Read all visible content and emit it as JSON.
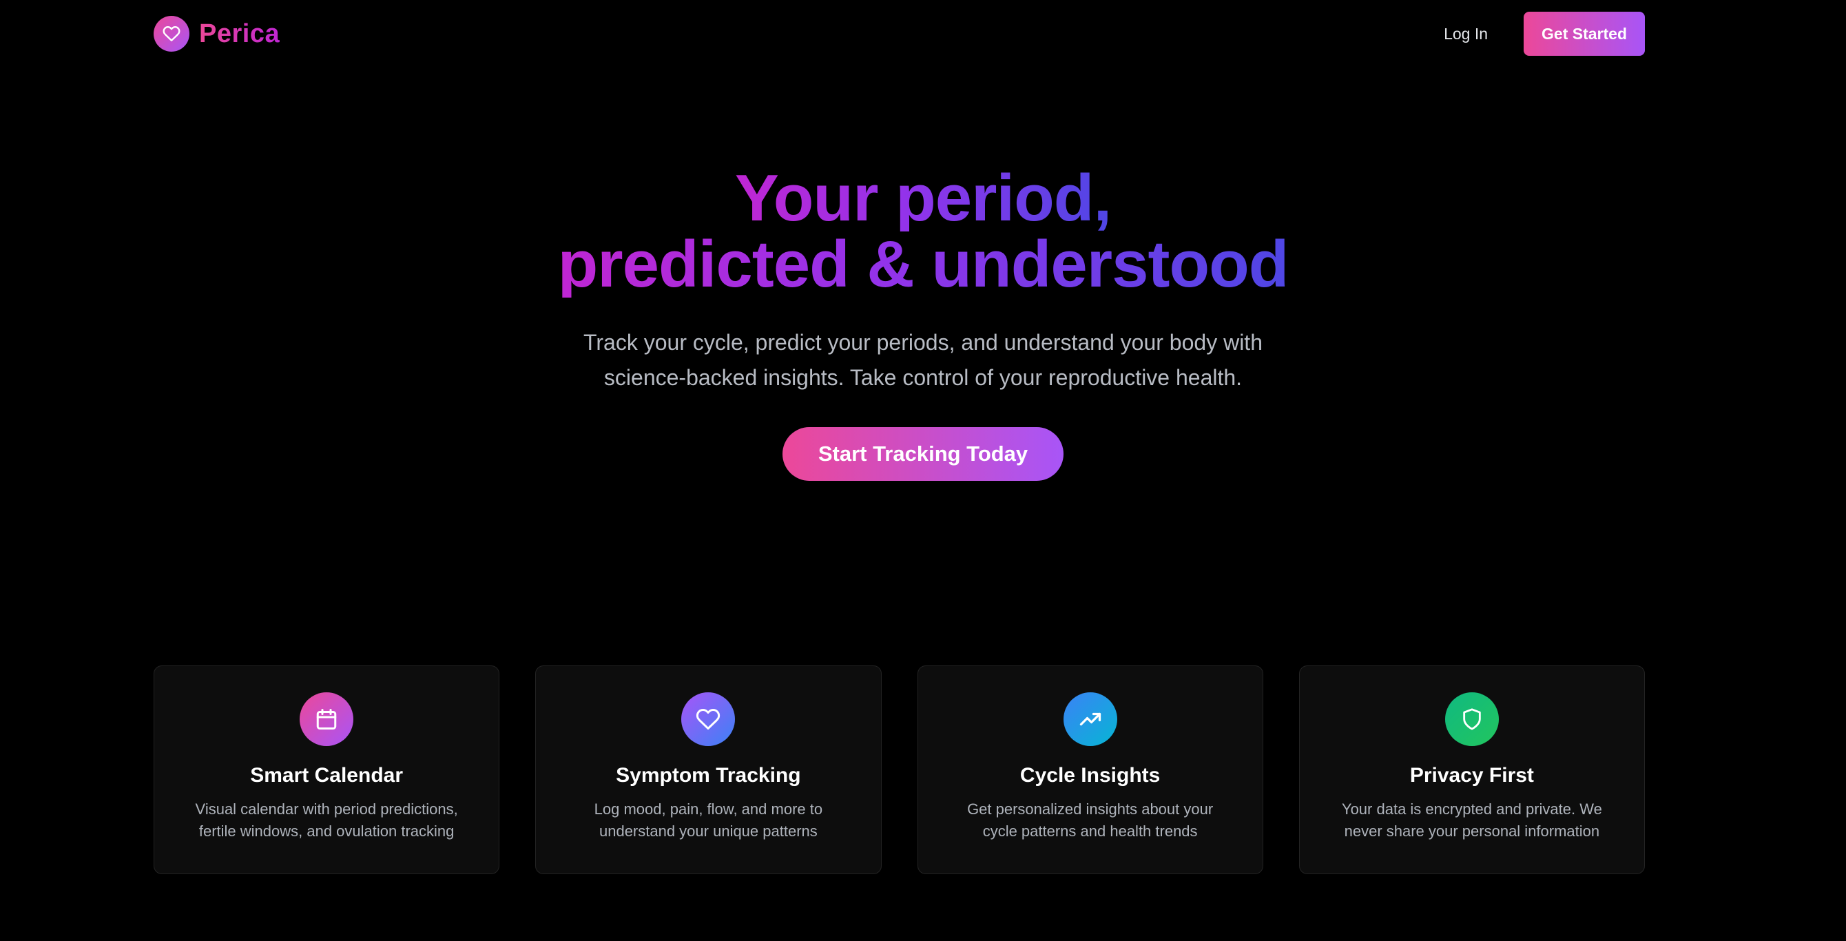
{
  "header": {
    "brand_name": "Perica",
    "login_label": "Log In",
    "get_started_label": "Get Started"
  },
  "hero": {
    "title_line1": "Your period,",
    "title_line2": "predicted & understood",
    "subtitle": "Track your cycle, predict your periods, and understand your body with science-backed insights. Take control of your reproductive health.",
    "cta_label": "Start Tracking Today"
  },
  "features": [
    {
      "icon": "calendar-icon",
      "title": "Smart Calendar",
      "description": "Visual calendar with period predictions, fertile windows, and ovulation tracking"
    },
    {
      "icon": "heart-icon",
      "title": "Symptom Tracking",
      "description": "Log mood, pain, flow, and more to understand your unique patterns"
    },
    {
      "icon": "trending-up-icon",
      "title": "Cycle Insights",
      "description": "Get personalized insights about your cycle patterns and health trends"
    },
    {
      "icon": "shield-icon",
      "title": "Privacy First",
      "description": "Your data is encrypted and private. We never share your personal information"
    }
  ],
  "colors": {
    "background": "#000000",
    "accent_pink": "#ec4899",
    "accent_purple": "#a855f7",
    "accent_indigo": "#4f46e5",
    "card_background": "#0d0d0d",
    "icon_gradients": [
      "#ec4899-#a855f7",
      "#a855f7-#3b82f6",
      "#3b82f6-#06b6d4",
      "#10b981-#22c55e"
    ]
  }
}
